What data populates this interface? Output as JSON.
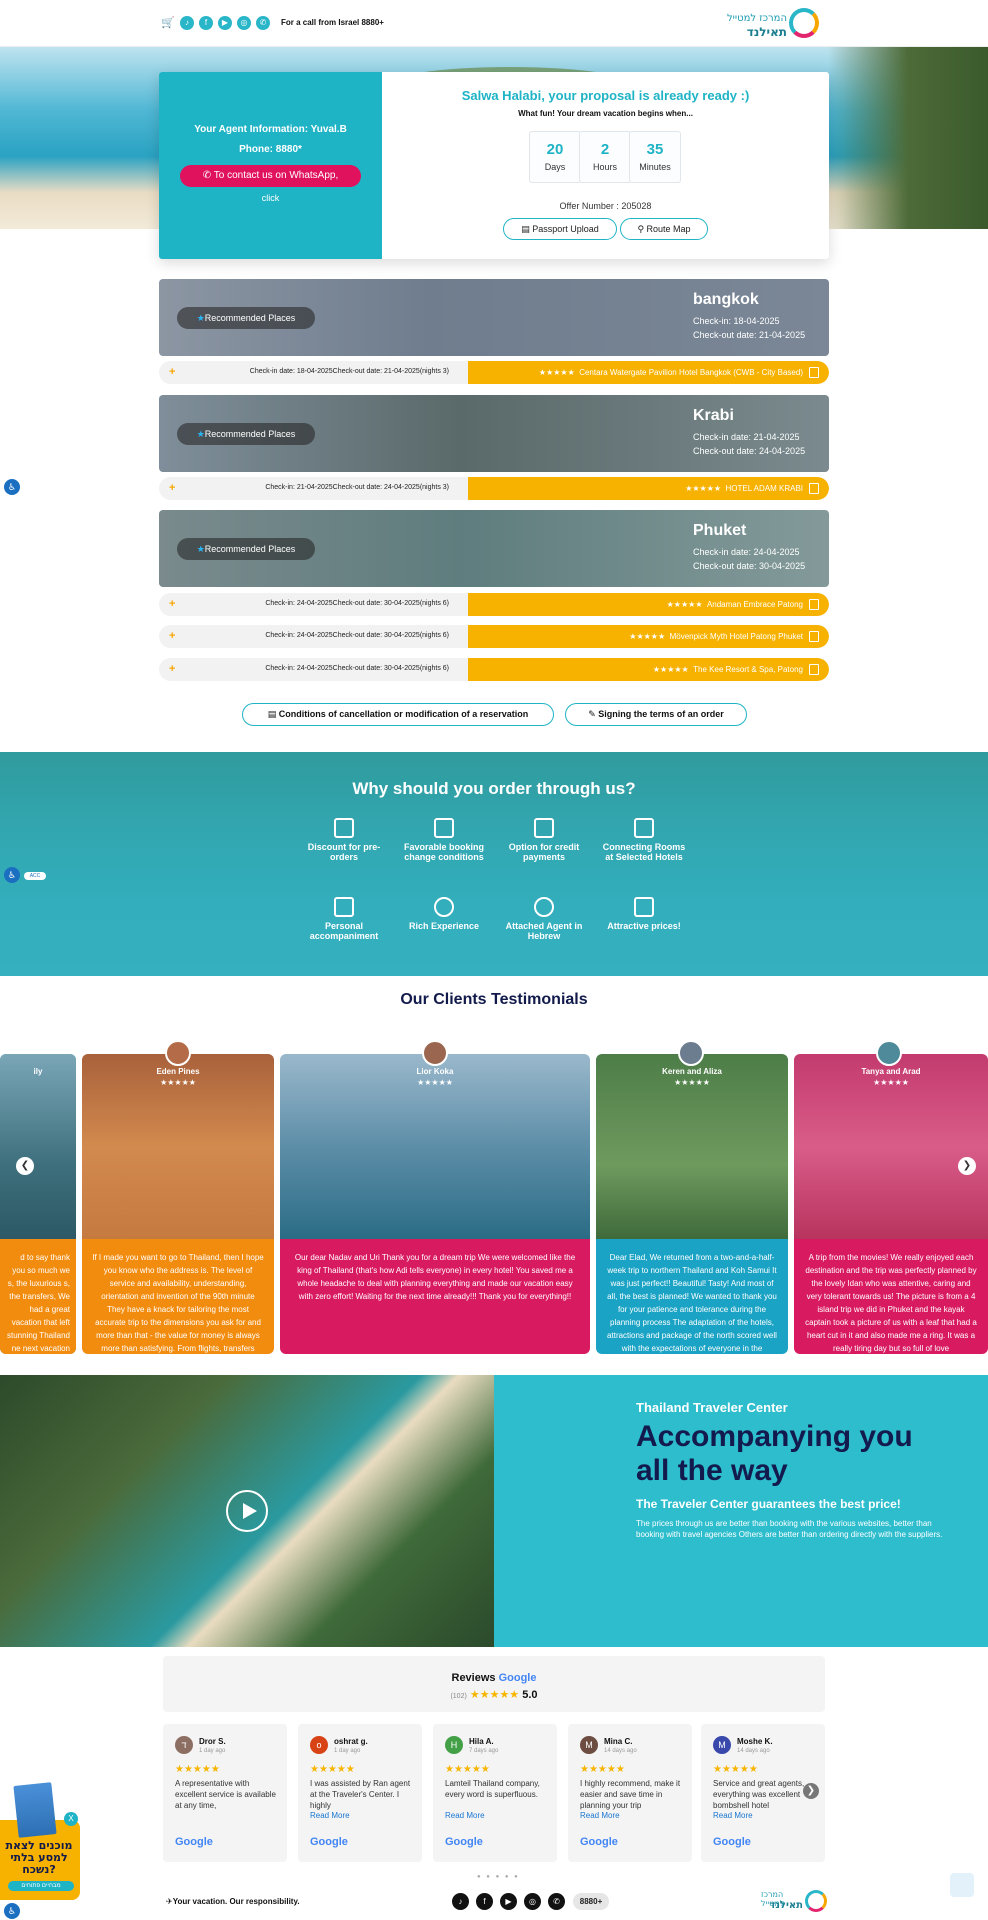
{
  "header": {
    "call_text": "For a call from Israel 8880+",
    "logo_line1": "המרכז למטייל",
    "logo_line2": "תאילנד",
    "social_icons": [
      "cart-icon",
      "tiktok-icon",
      "facebook-icon",
      "youtube-icon",
      "instagram-icon",
      "whatsapp-icon"
    ]
  },
  "agent": {
    "info": "Your Agent Information: Yuval.B",
    "phone": "Phone: 8880*",
    "whatsapp_btn": "To contact us on WhatsApp,",
    "click": "click"
  },
  "proposal": {
    "title": "Salwa Halabi, your proposal is already ready :)",
    "subtitle": "What fun! Your dream vacation begins when...",
    "countdown": [
      {
        "value": "20",
        "label": "Days"
      },
      {
        "value": "2",
        "label": "Hours"
      },
      {
        "value": "35",
        "label": "Minutes"
      }
    ],
    "offer": "Offer Number : 205028",
    "passport_btn": "Passport Upload",
    "route_btn": "Route Map"
  },
  "destinations": [
    {
      "rec": "Recommended Places",
      "city": "bangkok",
      "checkin": "Check-in: 18-04-2025",
      "checkout": "Check-out date: 21-04-2025"
    },
    {
      "rec": "Recommended Places",
      "city": "Krabi",
      "checkin": "Check-in date: 21-04-2025",
      "checkout": "Check-out date: 24-04-2025"
    },
    {
      "rec": "Recommended Places",
      "city": "Phuket",
      "checkin": "Check-in date: 24-04-2025",
      "checkout": "Check-out date: 30-04-2025"
    }
  ],
  "hotels": [
    {
      "dates": "Check-in date: 18-04-2025Check-out date: 21-04-2025(nights 3)",
      "name": "Centara Watergate Pavilion Hotel Bangkok (CWB - City Based)",
      "stars": "★★★★★"
    },
    {
      "dates": "Check-in: 21-04-2025Check-out date: 24-04-2025(nights 3)",
      "name": "HOTEL ADAM KRABI",
      "stars": "★★★★★"
    },
    {
      "dates": "Check-in: 24-04-2025Check-out date: 30-04-2025(nights 6)",
      "name": "Andaman Embrace Patong",
      "stars": "★★★★★"
    },
    {
      "dates": "Check-in: 24-04-2025Check-out date: 30-04-2025(nights 6)",
      "name": "Mövenpick Myth Hotel Patong Phuket",
      "stars": "★★★★★"
    },
    {
      "dates": "Check-in: 24-04-2025Check-out date: 30-04-2025(nights 6)",
      "name": "The Kee Resort & Spa, Patong",
      "stars": "★★★★★"
    }
  ],
  "actions": {
    "conditions": "Conditions of cancellation or modification of a reservation",
    "signing": "Signing the terms of an order"
  },
  "why": {
    "title": "Why should you order through us?",
    "features": [
      "Discount for pre-orders",
      "Favorable booking change conditions",
      "Option for credit payments",
      "Connecting Rooms at Selected Hotels",
      "Personal accompaniment",
      "Rich Experience",
      "Attached Agent in Hebrew",
      "Attractive prices!"
    ]
  },
  "testimonials": {
    "title": "Our Clients Testimonials",
    "items": [
      {
        "name": "Eden Pines",
        "stars": "★★★★★",
        "text": "If I made you want to go to Thailand, then I hope you know who the address is. The level of service and availability, understanding, orientation and invention of the 90th minute They have a knack for tailoring the most accurate trip to the dimensions you ask for and more than that - the value for money is always more than satisfying. From flights, transfers",
        "color": "#f28c0f"
      },
      {
        "name": "Lior Koka",
        "stars": "★★★★★",
        "text": "Our dear Nadav and Uri Thank you for a dream trip We were welcomed like the king of Thailand (that's how Adi tells everyone) in every hotel! You saved me a whole headache to deal with planning everything and made our vacation easy with zero effort! Waiting for the next time already!!! Thank you for everything!!",
        "color": "#d81b60"
      },
      {
        "name": "Keren and Aliza",
        "stars": "★★★★★",
        "text": "Dear Elad, We returned from a two-and-a-half-week trip to northern Thailand and Koh Samui It was just perfect!! Beautiful! Tasty! And most of all, the best is planned! We wanted to thank you for your patience and tolerance during the planning process The adaptation of the hotels, attractions and package of the north scored well with the expectations of everyone in the",
        "color": "#1aa3c4"
      },
      {
        "name": "Tanya and Arad",
        "stars": "★★★★★",
        "text": "A trip from the movies! We really enjoyed each destination and the trip was perfectly planned by the lovely Idan who was attentive, caring and very tolerant towards us! The picture is from a 4 island trip we did in Phuket and the kayak captain took a picture of us with a leaf that had a heart cut in it and also made me a ring. It was a really tiring day but so full of love",
        "color": "#d81b60"
      }
    ],
    "left_partial": "d to say thank you so much we s, the luxurious s, the transfers, We had a great vacation that left stunning Thailand ne next vacation in",
    "left_name": "ily"
  },
  "accompany": {
    "kicker": "Thailand Traveler Center",
    "title": "Accompanying you all the way",
    "sub": "The Traveler Center guarantees the best price!",
    "para": "The prices through us are better than booking with the various websites, better than booking with travel agencies Others are better than ordering directly with the suppliers."
  },
  "reviews": {
    "title": "Reviews",
    "brand": "Google",
    "count": "(102)",
    "stars": "★★★★★",
    "score": "5.0",
    "items": [
      {
        "initial": "ד",
        "name": "Dror S.",
        "ago": "1 day ago",
        "text": "A representative with excellent service is available at any time,",
        "more": "",
        "avatar": "#8d6e63"
      },
      {
        "initial": "o",
        "name": "oshrat g.",
        "ago": "1 day ago",
        "text": "I was assisted by Ran agent at the Traveler's Center. I highly",
        "more": "Read More",
        "avatar": "#d84315"
      },
      {
        "initial": "H",
        "name": "Hila A.",
        "ago": "7 days ago",
        "text": "Lamteil Thailand company, every word is superfluous.",
        "more": "Read More",
        "avatar": "#43a047"
      },
      {
        "initial": "M",
        "name": "Mina C.",
        "ago": "14 days ago",
        "text": "I highly recommend, make it easier and save time in planning your trip",
        "more": "Read More",
        "avatar": "#6d4c41"
      },
      {
        "initial": "M",
        "name": "Moshe K.",
        "ago": "14 days ago",
        "text": "Service and great agents, everything was excellent bombshell hotel",
        "more": "Read More",
        "avatar": "#3949ab"
      }
    ],
    "google_label": "Google"
  },
  "footer": {
    "slogan": "Your vacation. Our responsibility.",
    "phone": "8880+",
    "logo_line1": "המרכז למטייל",
    "logo_line2": "תאילנד"
  },
  "promo": {
    "text": "מוכנים לצאת למסע בלתי נשכח?",
    "badge": "מבחיים פתוחים",
    "close": "X"
  },
  "accessibility": {
    "label": "ACC"
  }
}
